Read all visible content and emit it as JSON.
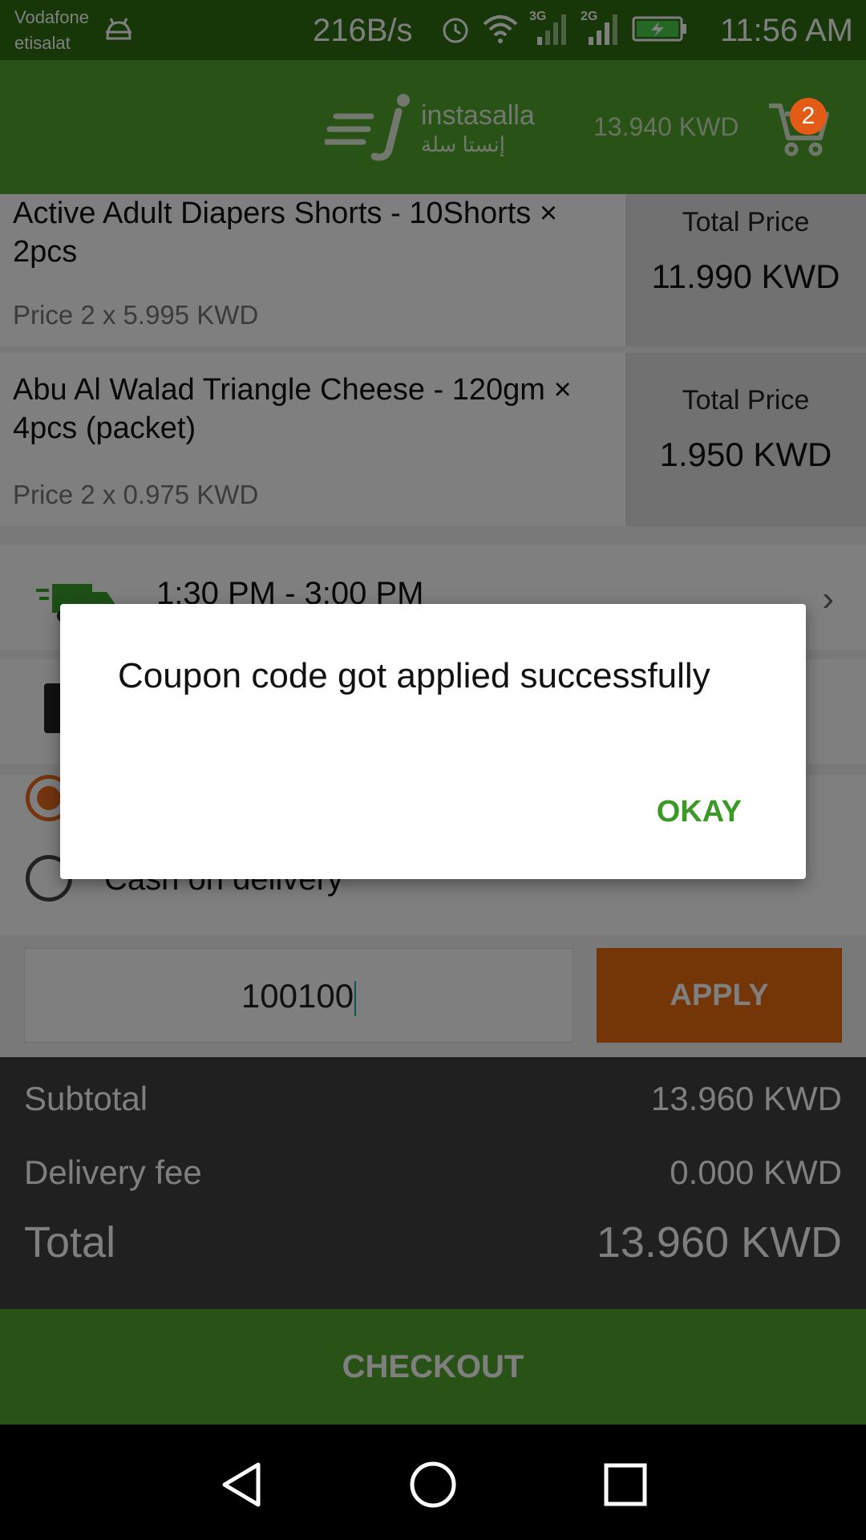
{
  "status_bar": {
    "carrier_1": "Vodafone",
    "carrier_2": "etisalat",
    "net_speed": "216B/s",
    "signal_1_label": "3G",
    "signal_2_label": "2G",
    "time": "11:56 AM"
  },
  "header": {
    "brand_name": "instasalla",
    "brand_name_arabic": "إنستا سلة",
    "cart_total": "13.940 KWD",
    "cart_count": "2"
  },
  "items": [
    {
      "name": "Active Adult Diapers Shorts - 10Shorts × 2pcs",
      "price_line": "Price 2 x 5.995  KWD",
      "total_label": "Total Price",
      "total_value": "11.990  KWD"
    },
    {
      "name": "Abu Al Walad Triangle Cheese - 120gm × 4pcs (packet)",
      "price_line": "Price 2 x 0.975  KWD",
      "total_label": "Total Price",
      "total_value": "1.950  KWD"
    }
  ],
  "delivery_slot": {
    "time": "1:30 PM - 3:00 PM"
  },
  "payment": {
    "cod_label": "Cash on delivery"
  },
  "coupon": {
    "value": "100100",
    "apply_label": "APPLY"
  },
  "summary": {
    "subtotal_label": "Subtotal",
    "subtotal_value": "13.960 KWD",
    "delivery_label": "Delivery fee",
    "delivery_value": "0.000 KWD",
    "total_label": "Total",
    "total_value": "13.960 KWD"
  },
  "checkout_label": "CHECKOUT",
  "dialog": {
    "message": "Coupon code got applied successfully",
    "ok_label": "OKAY"
  },
  "colors": {
    "brand_green": "#52a52d",
    "accent_orange": "#e86b0f",
    "ok_green": "#3a9a25"
  }
}
